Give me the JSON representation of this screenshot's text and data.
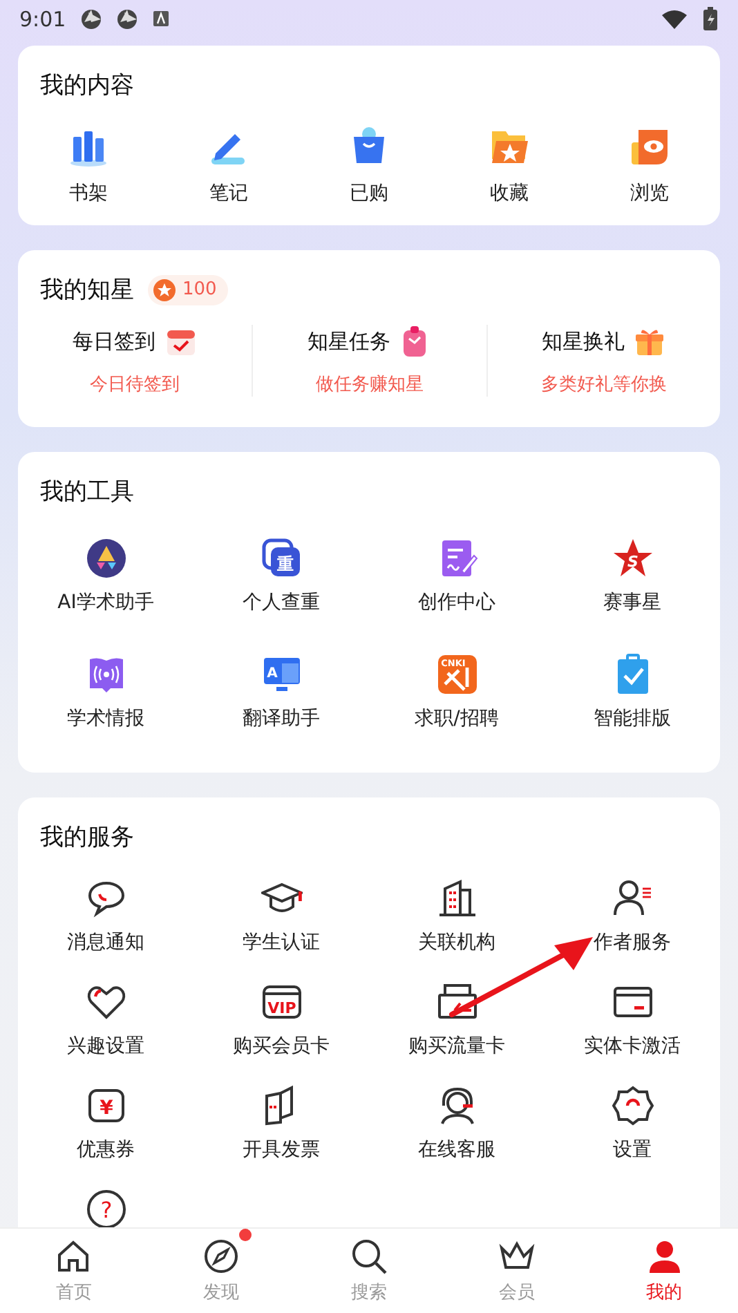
{
  "status_bar": {
    "time": "9:01"
  },
  "content": {
    "title": "我的内容",
    "items": [
      {
        "label": "书架"
      },
      {
        "label": "笔记"
      },
      {
        "label": "已购"
      },
      {
        "label": "收藏"
      },
      {
        "label": "浏览"
      }
    ]
  },
  "stars": {
    "title": "我的知星",
    "count": "100",
    "items": [
      {
        "title": "每日签到",
        "subtitle": "今日待签到"
      },
      {
        "title": "知星任务",
        "subtitle": "做任务赚知星"
      },
      {
        "title": "知星换礼",
        "subtitle": "多类好礼等你换"
      }
    ]
  },
  "tools": {
    "title": "我的工具",
    "items": [
      {
        "label": "AI学术助手"
      },
      {
        "label": "个人查重",
        "icon_text": "重"
      },
      {
        "label": "创作中心"
      },
      {
        "label": "赛事星",
        "icon_text": "S"
      },
      {
        "label": "学术情报"
      },
      {
        "label": "翻译助手",
        "icon_text": "A"
      },
      {
        "label": "求职/招聘",
        "icon_text": "CNKI"
      },
      {
        "label": "智能排版"
      }
    ]
  },
  "services": {
    "title": "我的服务",
    "items": [
      {
        "label": "消息通知"
      },
      {
        "label": "学生认证"
      },
      {
        "label": "关联机构"
      },
      {
        "label": "作者服务"
      },
      {
        "label": "兴趣设置"
      },
      {
        "label": "购买会员卡",
        "icon_text": "VIP"
      },
      {
        "label": "购买流量卡"
      },
      {
        "label": "实体卡激活"
      },
      {
        "label": "优惠券",
        "icon_text": "¥"
      },
      {
        "label": "开具发票"
      },
      {
        "label": "在线客服"
      },
      {
        "label": "设置"
      },
      {
        "icon_text": "?"
      }
    ]
  },
  "tab_bar": {
    "tabs": [
      {
        "label": "首页",
        "selected": false,
        "badge": false
      },
      {
        "label": "发现",
        "selected": false,
        "badge": true
      },
      {
        "label": "搜索",
        "selected": false,
        "badge": false
      },
      {
        "label": "会员",
        "selected": false,
        "badge": false
      },
      {
        "label": "我的",
        "selected": true,
        "badge": false
      }
    ]
  }
}
